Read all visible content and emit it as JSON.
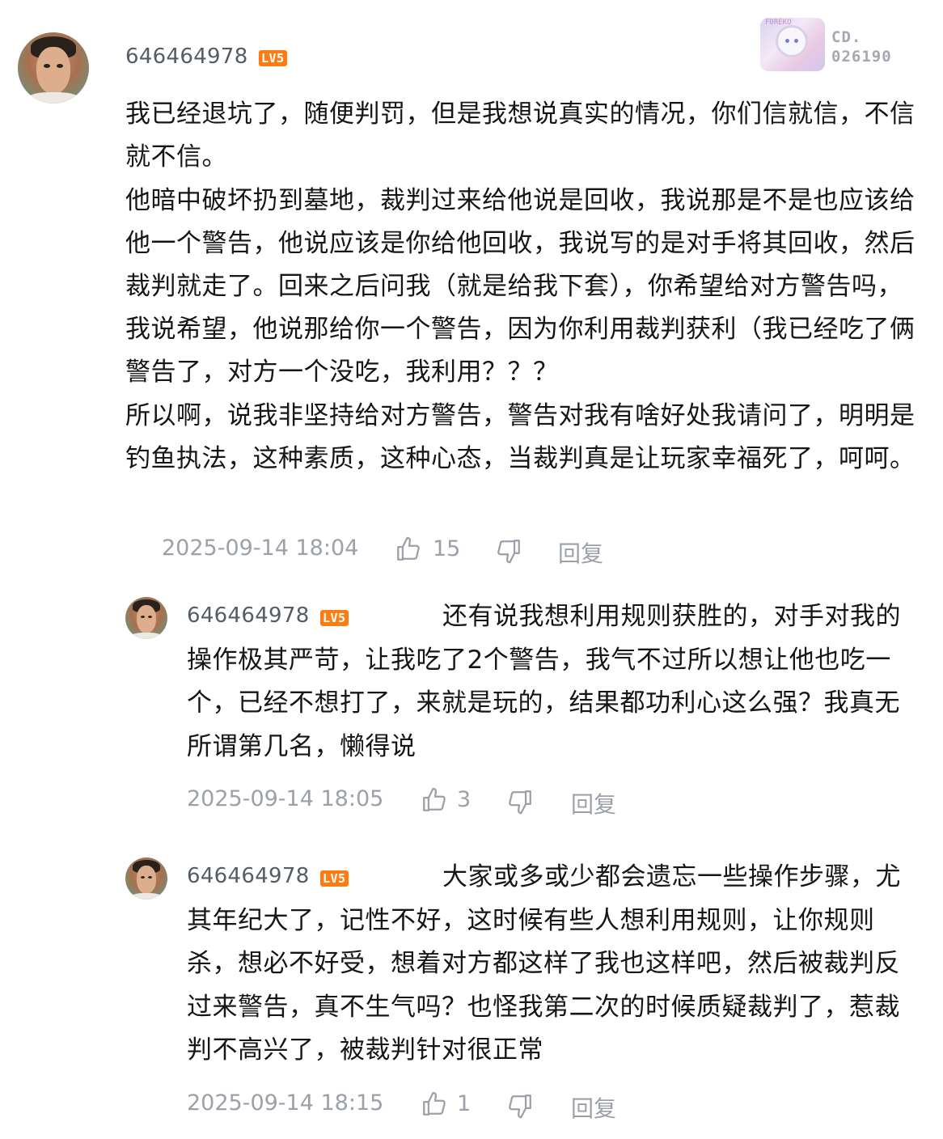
{
  "decoration": {
    "tag": "F0REKO",
    "line1": "CD.",
    "line2": "026190"
  },
  "main_comment": {
    "username": "646464978",
    "level": "LV5",
    "paragraphs": [
      "我已经退坑了，随便判罚，但是我想说真实的情况，你们信就信，不信就不信。",
      "他暗中破坏扔到墓地，裁判过来给他说是回收，我说那是不是也应该给他一个警告，他说应该是你给他回收，我说写的是对手将其回收，然后裁判就走了。回来之后问我（就是给我下套），你希望给对方警告吗，我说希望，他说那给你一个警告，因为你利用裁判获利（我已经吃了俩警告了，对方一个没吃，我利用？？？",
      "所以啊，说我非坚持给对方警告，警告对我有啥好处我请问了，明明是钓鱼执法，这种素质，这种心态，当裁判真是让玩家幸福死了，呵呵。"
    ],
    "time": "2025-09-14 18:04",
    "likes": "15",
    "reply_label": "回复"
  },
  "replies": [
    {
      "username": "646464978",
      "level": "LV5",
      "text": "还有说我想利用规则获胜的，对手对我的操作极其严苛，让我吃了2个警告，我气不过所以想让他也吃一个，已经不想打了，来就是玩的，结果都功利心这么强？我真无所谓第几名，懒得说",
      "time": "2025-09-14 18:05",
      "likes": "3",
      "reply_label": "回复"
    },
    {
      "username": "646464978",
      "level": "LV5",
      "text": "大家或多或少都会遗忘一些操作步骤，尤其年纪大了，记性不好，这时候有些人想利用规则，让你规则杀，想必不好受，想着对方都这样了我也这样吧，然后被裁判反过来警告，真不生气吗？也怪我第二次的时候质疑裁判了，惹裁判不高兴了，被裁判针对很正常",
      "time": "2025-09-14 18:15",
      "likes": "1",
      "reply_label": "回复"
    }
  ]
}
